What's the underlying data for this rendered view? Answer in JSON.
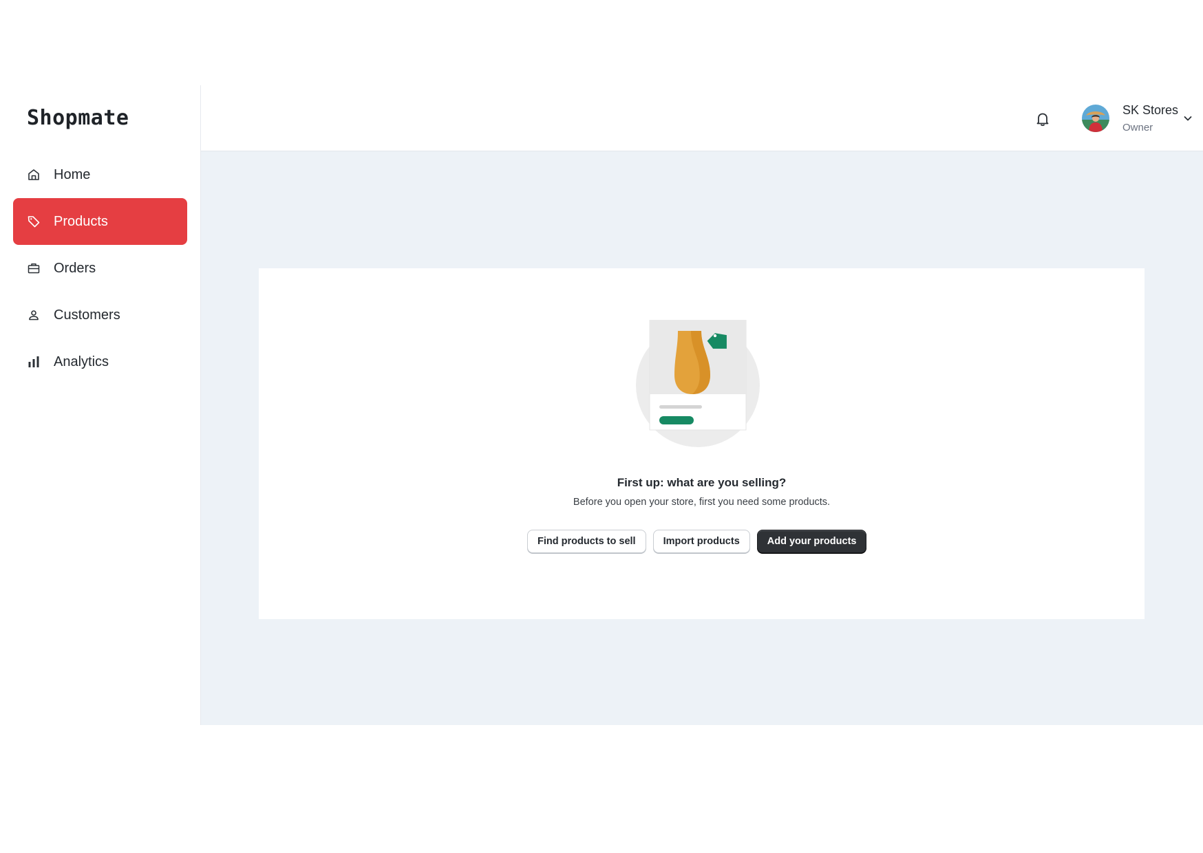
{
  "app": {
    "name": "Shopmate"
  },
  "sidebar": {
    "items": [
      {
        "label": "Home",
        "icon": "home-icon",
        "active": false
      },
      {
        "label": "Products",
        "icon": "tag-icon",
        "active": true
      },
      {
        "label": "Orders",
        "icon": "briefcase-icon",
        "active": false
      },
      {
        "label": "Customers",
        "icon": "person-icon",
        "active": false
      },
      {
        "label": "Analytics",
        "icon": "bar-chart-icon",
        "active": false
      }
    ]
  },
  "header": {
    "notifications_icon": "bell-icon",
    "user": {
      "name": "SK Stores",
      "role": "Owner"
    }
  },
  "empty_state": {
    "title": "First up: what are you selling?",
    "description": "Before you open your store, first you need some products.",
    "buttons": {
      "find": "Find products to sell",
      "import": "Import products",
      "add": "Add your products"
    }
  },
  "colors": {
    "accent": "#e53e42",
    "primary_button": "#2f3236",
    "content_background": "#edf2f7",
    "tag_green": "#178a63",
    "vase_orange": "#e3a23b"
  }
}
